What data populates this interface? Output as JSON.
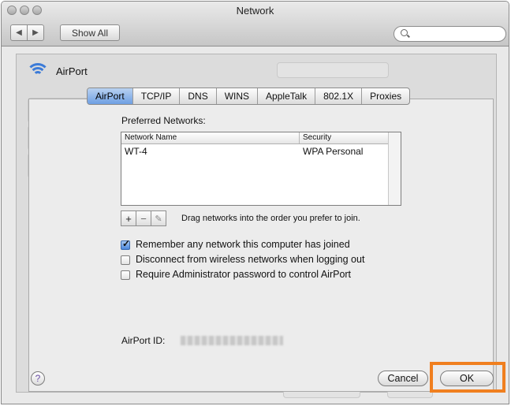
{
  "window": {
    "title": "Network"
  },
  "toolbar": {
    "back_label": "◀",
    "forward_label": "▶",
    "show_all_label": "Show All",
    "search_placeholder": ""
  },
  "header": {
    "service_name": "AirPort"
  },
  "tabs": [
    {
      "label": "AirPort",
      "selected": true
    },
    {
      "label": "TCP/IP",
      "selected": false
    },
    {
      "label": "DNS",
      "selected": false
    },
    {
      "label": "WINS",
      "selected": false
    },
    {
      "label": "AppleTalk",
      "selected": false
    },
    {
      "label": "802.1X",
      "selected": false
    },
    {
      "label": "Proxies",
      "selected": false
    }
  ],
  "preferred": {
    "label": "Preferred Networks:",
    "columns": [
      "Network Name",
      "Security"
    ],
    "rows": [
      {
        "name": "WT-4",
        "security": "WPA Personal"
      }
    ],
    "add_label": "+",
    "remove_label": "−",
    "edit_label": "✎",
    "hint": "Drag networks into the order you prefer to join."
  },
  "options": [
    {
      "label": "Remember any network this computer has joined",
      "checked": true
    },
    {
      "label": "Disconnect from wireless networks when logging out",
      "checked": false
    },
    {
      "label": "Require Administrator password to control AirPort",
      "checked": false
    }
  ],
  "airport_id": {
    "label": "AirPort ID:"
  },
  "footer": {
    "help_label": "?",
    "cancel_label": "Cancel",
    "ok_label": "OK"
  },
  "colors": {
    "highlight": "#f07f1f",
    "selected_tab": "#6e9fe3",
    "wifi": "#3b7bd8"
  }
}
